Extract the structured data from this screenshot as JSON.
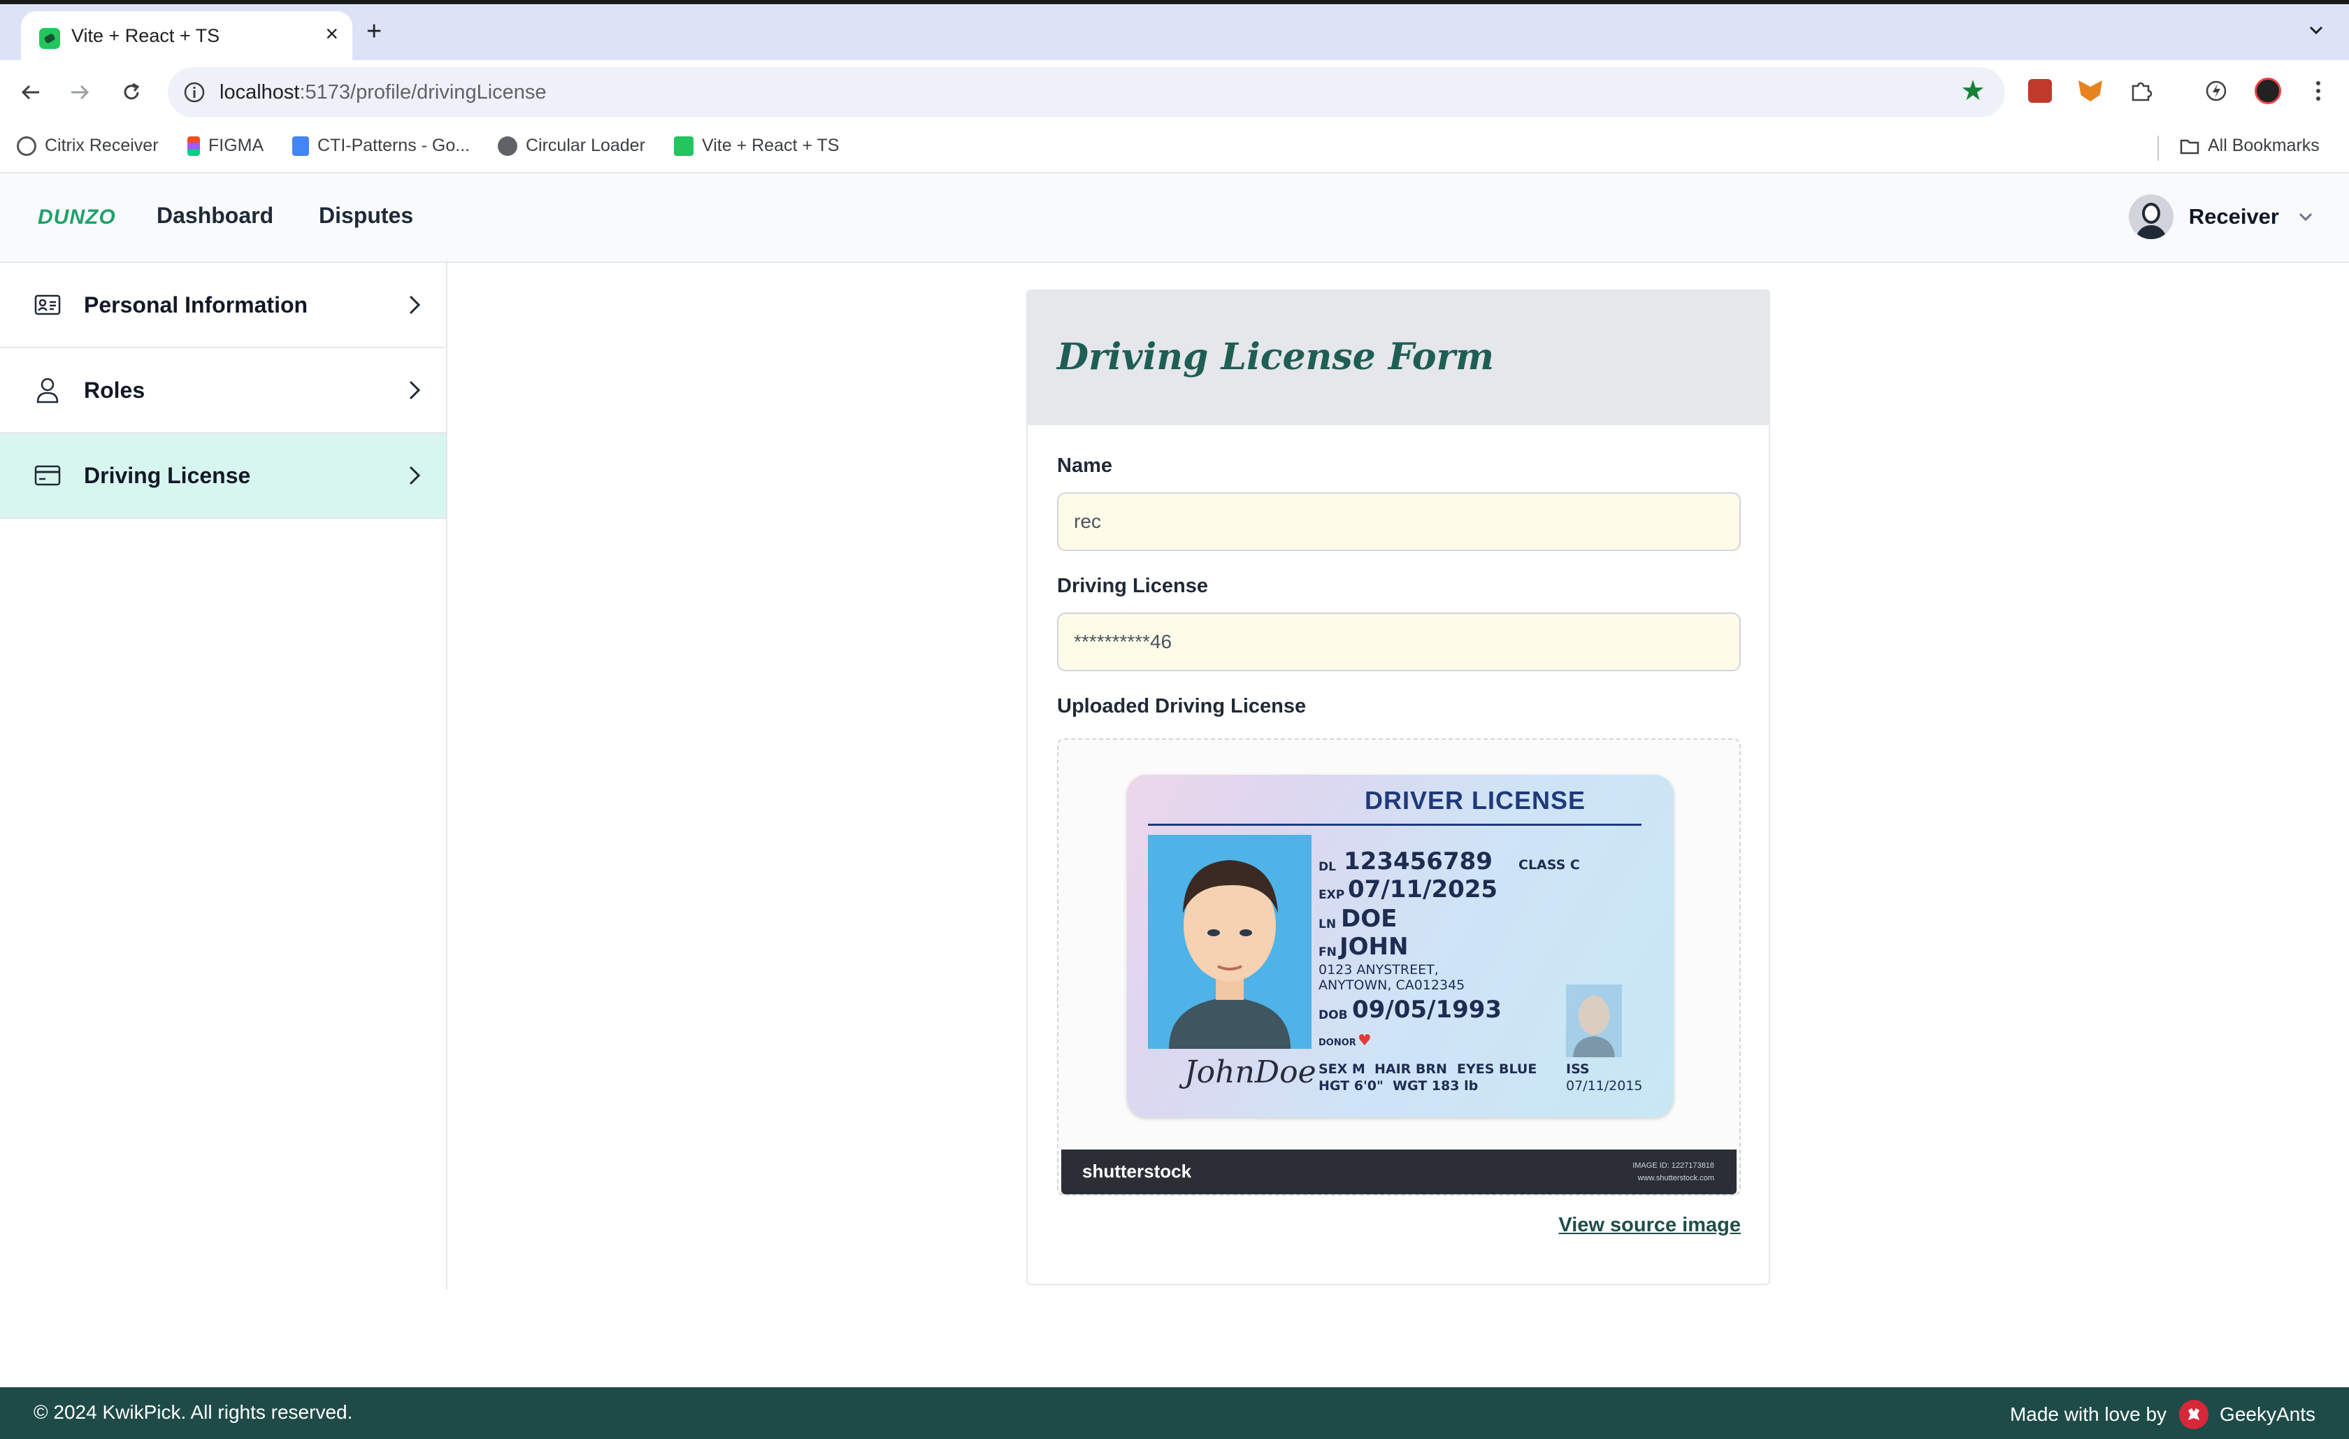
{
  "browser": {
    "tab_title": "Vite + React + TS",
    "url_host": "localhost",
    "url_path": ":5173/profile/drivingLicense",
    "bookmarks": [
      {
        "label": "Citrix Receiver",
        "icon": "citrix-icon"
      },
      {
        "label": "FIGMA",
        "icon": "figma-icon"
      },
      {
        "label": "CTI-Patterns - Go...",
        "icon": "google-docs-icon"
      },
      {
        "label": "Circular Loader",
        "icon": "globe-icon"
      },
      {
        "label": "Vite + React + TS",
        "icon": "vite-icon"
      }
    ],
    "all_bookmarks": "All Bookmarks"
  },
  "header": {
    "logo": "DUNZO",
    "nav": [
      "Dashboard",
      "Disputes"
    ],
    "user_name": "Receiver"
  },
  "sidebar": {
    "items": [
      {
        "label": "Personal Information",
        "icon": "id-card-icon",
        "active": false
      },
      {
        "label": "Roles",
        "icon": "user-icon",
        "active": false
      },
      {
        "label": "Driving License",
        "icon": "credit-card-icon",
        "active": true
      }
    ]
  },
  "form": {
    "title": "Driving License Form",
    "name_label": "Name",
    "name_value": "rec",
    "license_label": "Driving License",
    "license_value": "**********46",
    "uploaded_label": "Uploaded Driving License",
    "view_source": "View source image"
  },
  "license_image": {
    "title": "DRIVER LICENSE",
    "dl_key": "DL",
    "dl_value": "123456789",
    "class_label": "CLASS C",
    "exp_key": "EXP",
    "exp_value": "07/11/2025",
    "ln_key": "LN",
    "ln_value": "DOE",
    "fn_key": "FN",
    "fn_value": "JOHN",
    "address_1": "0123 ANYSTREET,",
    "address_2": "ANYTOWN, CA012345",
    "dob_key": "DOB",
    "dob_value": "09/05/1993",
    "donor": "DONOR",
    "sex": "SEX M",
    "hair": "HAIR BRN",
    "eyes": "EYES BLUE",
    "hgt": "HGT 6'0\"",
    "wgt": "WGT 183 lb",
    "iss_key": "ISS",
    "iss_value": "07/11/2015",
    "signature": "JohnDoe",
    "watermark_brand": "shutterstock",
    "image_id": "IMAGE ID: 1227173818",
    "watermark_site": "www.shutterstock.com"
  },
  "footer": {
    "copyright": "© 2024 KwikPick. All rights reserved.",
    "made_with": "Made with love by",
    "brand": "GeekyAnts"
  },
  "colors": {
    "brand_green": "#22a06b",
    "title_teal": "#1f5e55",
    "active_bg": "#d7f7ee",
    "footer_bg": "#1e4b47",
    "input_bg": "#fefce8"
  }
}
